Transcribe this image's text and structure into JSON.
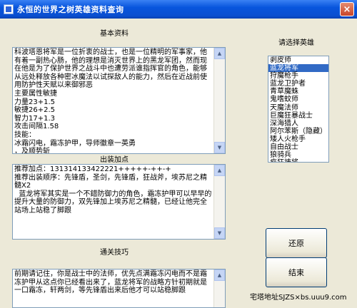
{
  "window": {
    "title": "永恒的世界之树英雄资料查询",
    "close_glyph": "×"
  },
  "basic_info": {
    "label": "基本资料",
    "text": "科波塔恩将军是一位折衷的战士，也是一位精明的军事家，他有着一副热心肠，他的理想是消灭世界上的黑龙军团，然而现在他是为了保护世界之战斗中也遭劳派谁指挥官的角色，能够从远处释放各种密冰魔法以试探敌人的能力，然后在近战前使用防护性天赋以来御邪恶\n主要属性敏捷\n力量23+1.5\n敏捷26+2.5\n智力17+1.3\n攻击间隔1.58\n技能：\n冰霜闪电，霜冻护甲，导师徽章一英勇\n，及顺势斩"
  },
  "equipment": {
    "label": "出装加点",
    "text": "推荐加点：131314133422221+++++-++-+\n推荐出装顺序：先锋盾，圣剑，先锋盾，狂战斧，埃苏尼之精髓X2\n  蓝龙将军其实是一个不錯防御力的角色，霜冻护甲可以早早的提升大量的防御力，双先锋加上埃苏尼之精髓，已经让他完全站场上站稳了脚跟"
  },
  "tips": {
    "label": "通关技巧",
    "text": "前期请记住，你是战士中的法师，优先点满霜冻闪电而不是霜冻护甲从这点你已经看出来了，蓝龙将军的战略方针初期就是一口霜冻，轩两剑，等先锋盾出来后他才可以站稳脚跟"
  },
  "hero_select": {
    "label": "请选择英雄",
    "selected_index": 1,
    "items": [
      "剥皮师",
      "蓝龙将军",
      "狩魔枪手",
      "蓝龙卫护者",
      "青草魔蛛",
      "鬼嗜蚊师",
      "天魔法师",
      "巨魔狂暴战士",
      "深海猎人",
      "阿尔苯斯（隐藏）",
      "矮人火枪手",
      "自由战士",
      "狼骑兵",
      "疯狂祷将"
    ]
  },
  "buttons": {
    "restore": "还原",
    "exit": "结束"
  },
  "footer": {
    "text": "宅塔地址SJZS×bs.uuu9.com"
  }
}
